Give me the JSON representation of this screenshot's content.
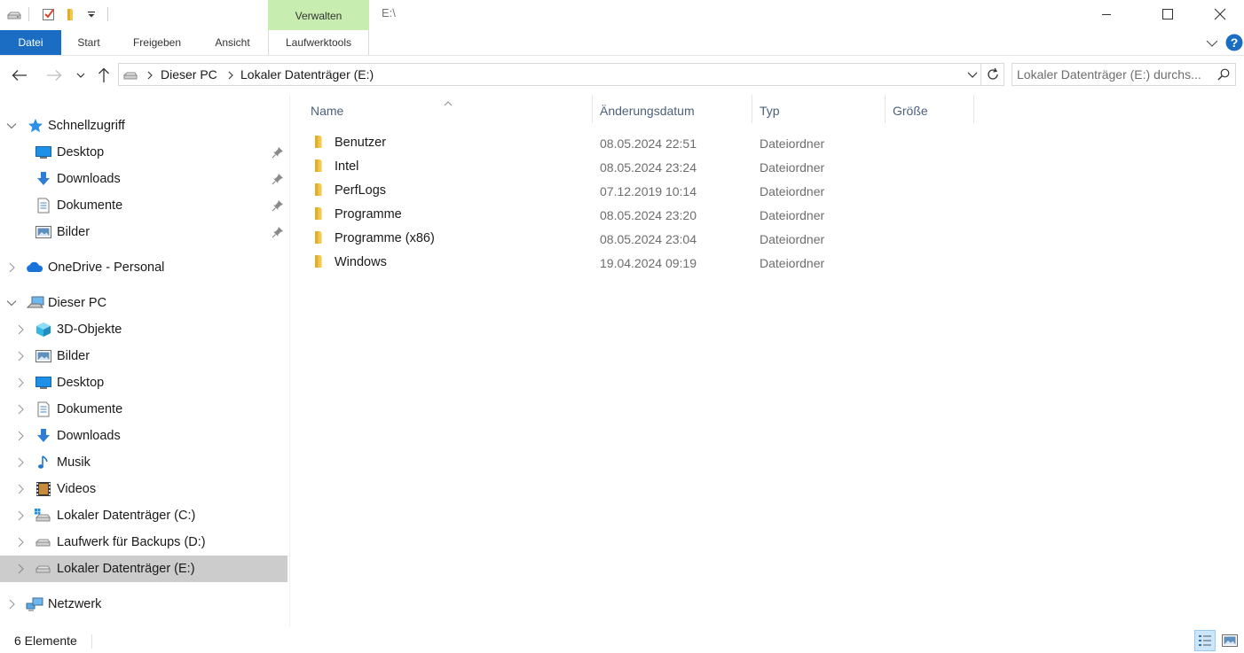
{
  "titlebar": {
    "context_tab": "Verwalten",
    "path": "E:\\"
  },
  "ribbon": {
    "tabs": [
      {
        "label": "Datei"
      },
      {
        "label": "Start"
      },
      {
        "label": "Freigeben"
      },
      {
        "label": "Ansicht"
      },
      {
        "label": "Laufwerktools"
      }
    ]
  },
  "address": {
    "crumbs": [
      "Dieser PC",
      "Lokaler Datenträger (E:)"
    ],
    "search_placeholder": "Lokaler Datenträger (E:) durchs..."
  },
  "navpane": {
    "quick_access": {
      "label": "Schnellzugriff",
      "items": [
        {
          "label": "Desktop",
          "icon": "desktop-icon"
        },
        {
          "label": "Downloads",
          "icon": "downloads-icon"
        },
        {
          "label": "Dokumente",
          "icon": "documents-icon"
        },
        {
          "label": "Bilder",
          "icon": "pictures-icon"
        }
      ]
    },
    "onedrive": {
      "label": "OneDrive - Personal"
    },
    "this_pc": {
      "label": "Dieser PC",
      "items": [
        {
          "label": "3D-Objekte",
          "icon": "3d-objects-icon"
        },
        {
          "label": "Bilder",
          "icon": "pictures-icon"
        },
        {
          "label": "Desktop",
          "icon": "desktop-icon"
        },
        {
          "label": "Dokumente",
          "icon": "documents-icon"
        },
        {
          "label": "Downloads",
          "icon": "downloads-icon"
        },
        {
          "label": "Musik",
          "icon": "music-icon"
        },
        {
          "label": "Videos",
          "icon": "videos-icon"
        },
        {
          "label": "Lokaler Datenträger (C:)",
          "icon": "windows-drive-icon"
        },
        {
          "label": "Laufwerk für Backups (D:)",
          "icon": "drive-icon"
        },
        {
          "label": "Lokaler Datenträger (E:)",
          "icon": "drive-icon"
        }
      ]
    },
    "network": {
      "label": "Netzwerk"
    }
  },
  "filelist": {
    "columns": [
      "Name",
      "Änderungsdatum",
      "Typ",
      "Größe"
    ],
    "rows": [
      {
        "name": "Benutzer",
        "date": "08.05.2024 22:51",
        "type": "Dateiordner"
      },
      {
        "name": "Intel",
        "date": "08.05.2024 23:24",
        "type": "Dateiordner"
      },
      {
        "name": "PerfLogs",
        "date": "07.12.2019 10:14",
        "type": "Dateiordner"
      },
      {
        "name": "Programme",
        "date": "08.05.2024 23:20",
        "type": "Dateiordner"
      },
      {
        "name": "Programme (x86)",
        "date": "08.05.2024 23:04",
        "type": "Dateiordner"
      },
      {
        "name": "Windows",
        "date": "19.04.2024 09:19",
        "type": "Dateiordner"
      }
    ]
  },
  "status": {
    "count": "6 Elemente"
  },
  "colors": {
    "accent": "#1a6dc2",
    "context_tab": "#c7edb0",
    "selected_nav": "#cccccc",
    "folder": "#f3c94d"
  }
}
